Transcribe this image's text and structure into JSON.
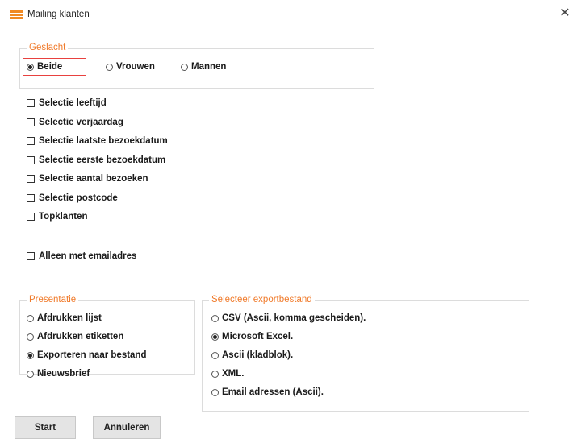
{
  "window": {
    "title": "Mailing klanten",
    "close_glyph": "✕"
  },
  "gender": {
    "legend": "Geslacht",
    "options": [
      {
        "label": "Beide",
        "selected": true
      },
      {
        "label": "Vrouwen",
        "selected": false
      },
      {
        "label": "Mannen",
        "selected": false
      }
    ]
  },
  "selections": [
    {
      "label": "Selectie leeftijd",
      "checked": false
    },
    {
      "label": "Selectie verjaardag",
      "checked": false
    },
    {
      "label": "Selectie laatste bezoekdatum",
      "checked": false
    },
    {
      "label": "Selectie eerste bezoekdatum",
      "checked": false
    },
    {
      "label": "Selectie aantal bezoeken",
      "checked": false
    },
    {
      "label": "Selectie postcode",
      "checked": false
    },
    {
      "label": "Topklanten",
      "checked": false
    }
  ],
  "email_only": {
    "label": "Alleen met emailadres",
    "checked": false
  },
  "presentation": {
    "legend": "Presentatie",
    "options": [
      {
        "label": "Afdrukken lijst",
        "selected": false
      },
      {
        "label": "Afdrukken etiketten",
        "selected": false
      },
      {
        "label": "Exporteren naar bestand",
        "selected": true
      },
      {
        "label": "Nieuwsbrief",
        "selected": false
      }
    ]
  },
  "export": {
    "legend": "Selecteer exportbestand",
    "options": [
      {
        "label": "CSV (Ascii, komma gescheiden).",
        "selected": false
      },
      {
        "label": "Microsoft Excel.",
        "selected": true
      },
      {
        "label": "Ascii (kladblok).",
        "selected": false
      },
      {
        "label": "XML.",
        "selected": false
      },
      {
        "label": "Email adressen (Ascii).",
        "selected": false
      }
    ]
  },
  "buttons": {
    "start": "Start",
    "cancel": "Annuleren"
  },
  "colors": {
    "accent": "#f07a2a",
    "focus_border": "#e8413f",
    "button_bg": "#e4e4e4"
  }
}
